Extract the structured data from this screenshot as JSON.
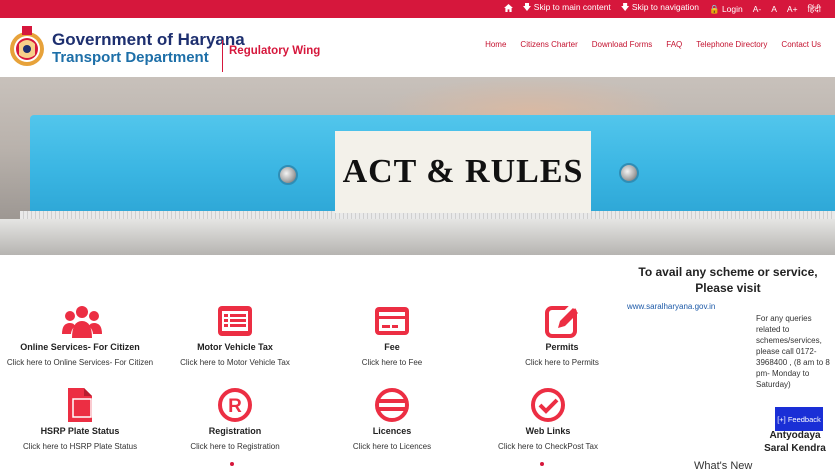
{
  "topbar": {
    "home_icon": "home-icon",
    "skip_main": "🡇 Skip to main content",
    "skip_nav": "🡇 Skip to navigation",
    "login": "🔒 Login",
    "font_small": "A-",
    "font_normal": "A",
    "font_large": "A+",
    "hindi": "हिंदी"
  },
  "header": {
    "gov_title": "Government of Haryana",
    "dept_title": "Transport Department",
    "wing": "Regulatory Wing",
    "nav": [
      "Home",
      "Citizens Charter",
      "Download Forms",
      "FAQ",
      "Telephone Directory",
      "Contact Us"
    ]
  },
  "banner": {
    "label": "ACT & RULES"
  },
  "side": {
    "heading": "To avail any scheme or service, Please visit",
    "link": "www.saralharyana.gov.in",
    "queries": "For any queries related to schemes/services, please call 0172-3968400 , (8 am to 8 pm- Monday to Saturday)",
    "kendra": "List of Antyodaya Saral Kendra",
    "feedback": "[+] Feedback",
    "whats_new": "What's New"
  },
  "cards": [
    {
      "title": "Online Services- For Citizen",
      "sub": "Click here to Online Services- For Citizen",
      "icon": "users-icon"
    },
    {
      "title": "Motor Vehicle Tax",
      "sub": "Click here to Motor Vehicle Tax",
      "icon": "list-icon"
    },
    {
      "title": "Fee",
      "sub": "Click here to Fee",
      "icon": "credit-card-icon"
    },
    {
      "title": "Permits",
      "sub": "Click here to Permits",
      "icon": "edit-icon"
    },
    {
      "title": "HSRP Plate Status",
      "sub": "Click here to HSRP Plate Status",
      "icon": "document-icon"
    },
    {
      "title": "Registration",
      "sub": "Click here to Registration",
      "icon": "registered-icon"
    },
    {
      "title": "Licences",
      "sub": "Click here to Licences",
      "icon": "licence-icon"
    },
    {
      "title": "Web Links",
      "sub": "Click here to CheckPost Tax",
      "icon": "check-circle-icon"
    }
  ],
  "colors": {
    "brand_red": "#d6173c",
    "navy": "#1d2f6f",
    "blue": "#1d6fa8",
    "feedback": "#1a2fd6"
  }
}
